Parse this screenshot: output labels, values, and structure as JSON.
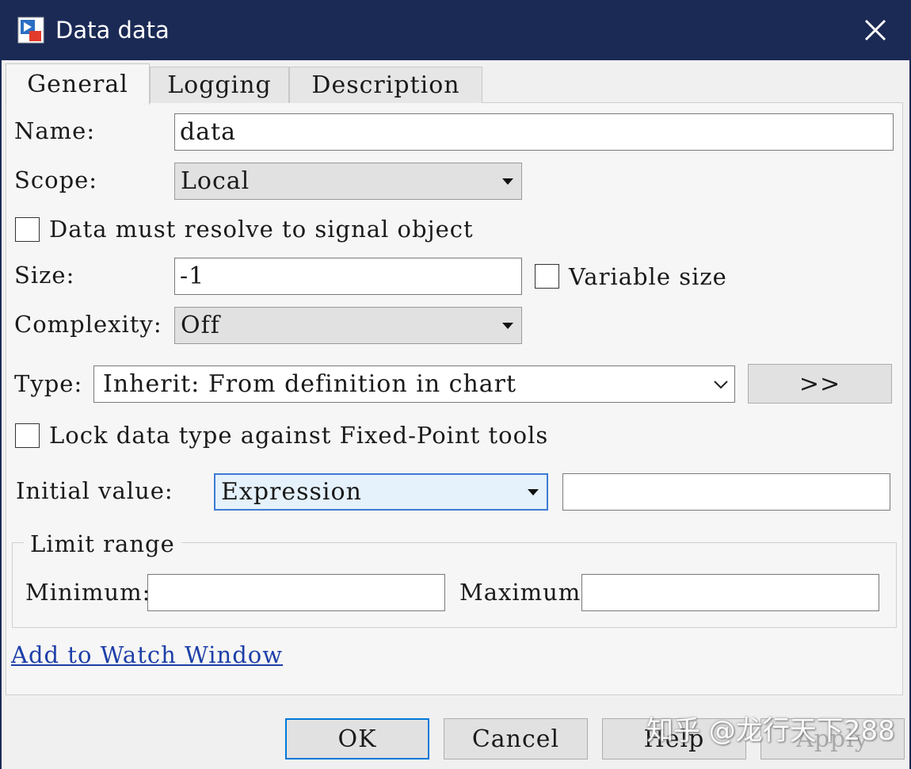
{
  "window": {
    "title": "Data data",
    "app_icon": "simulink-model-icon",
    "close_icon": "close-icon"
  },
  "tabs": [
    {
      "label": "General",
      "active": true
    },
    {
      "label": "Logging",
      "active": false
    },
    {
      "label": "Description",
      "active": false
    }
  ],
  "general": {
    "name_label": "Name:",
    "name_value": "data",
    "scope_label": "Scope:",
    "scope_value": "Local",
    "resolve_signal_label": "Data must resolve to signal object",
    "resolve_signal_checked": false,
    "size_label": "Size:",
    "size_value": "-1",
    "variable_size_label": "Variable size",
    "variable_size_checked": false,
    "complexity_label": "Complexity:",
    "complexity_value": "Off",
    "type_label": "Type:",
    "type_value": "Inherit: From definition in chart",
    "type_assistant_label": ">>",
    "lock_type_label": "Lock data type against Fixed-Point tools",
    "lock_type_checked": false,
    "initial_value_label": "Initial value:",
    "initial_value_mode": "Expression",
    "initial_value_value": ""
  },
  "limit_range": {
    "title": "Limit range",
    "minimum_label": "Minimum:",
    "minimum_value": "",
    "maximum_label": "Maximum:",
    "maximum_value": ""
  },
  "watch_link": "Add to Watch Window",
  "buttons": {
    "ok": "OK",
    "cancel": "Cancel",
    "help": "Help",
    "apply": "Apply"
  },
  "watermark": "知乎 @龙行天下288",
  "colors": {
    "titlebar": "#1b2a55",
    "focus_border": "#3d7bd3",
    "link": "#1d3fa8",
    "default_button_border": "#0078d7"
  }
}
